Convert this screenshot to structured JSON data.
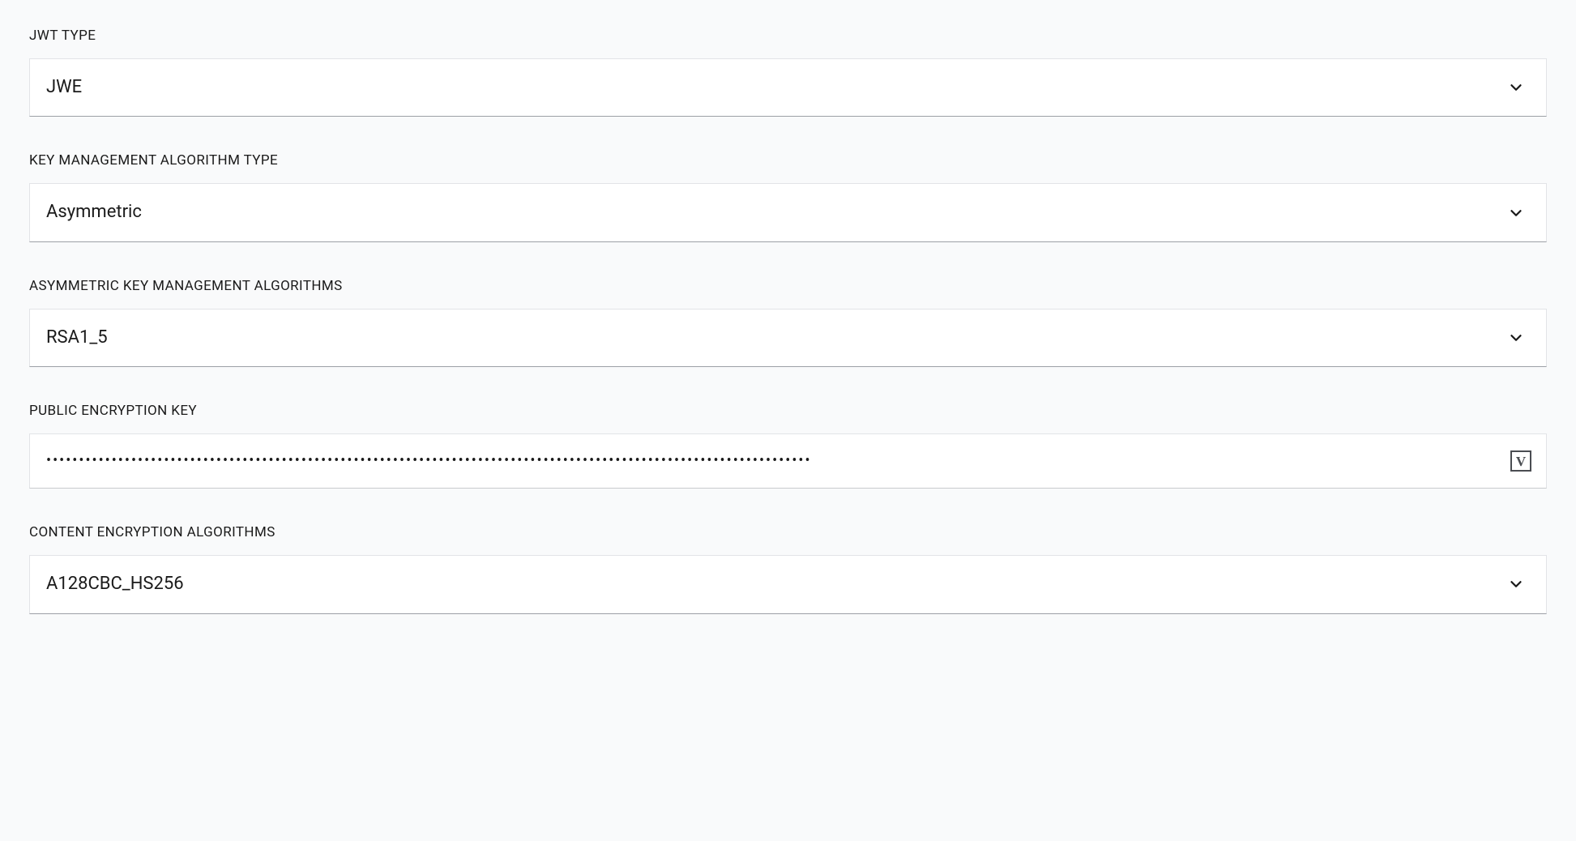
{
  "form": {
    "jwt_type": {
      "label": "JWT TYPE",
      "value": "JWE"
    },
    "key_mgmt_type": {
      "label": "KEY MANAGEMENT ALGORITHM TYPE",
      "value": "Asymmetric"
    },
    "asym_key_algo": {
      "label": "ASYMMETRIC KEY MANAGEMENT ALGORITHMS",
      "value": "RSA1_5"
    },
    "public_enc_key": {
      "label": "PUBLIC ENCRYPTION KEY",
      "value": "•••••••••••••••••••••••••••••••••••••••••••••••••••••••••••••••••••••••••••••••••••••••••••••••••••••••••••••••••••••"
    },
    "content_enc_algo": {
      "label": "CONTENT ENCRYPTION ALGORITHMS",
      "value": "A128CBC_HS256"
    },
    "vault_icon_letter": "V"
  }
}
